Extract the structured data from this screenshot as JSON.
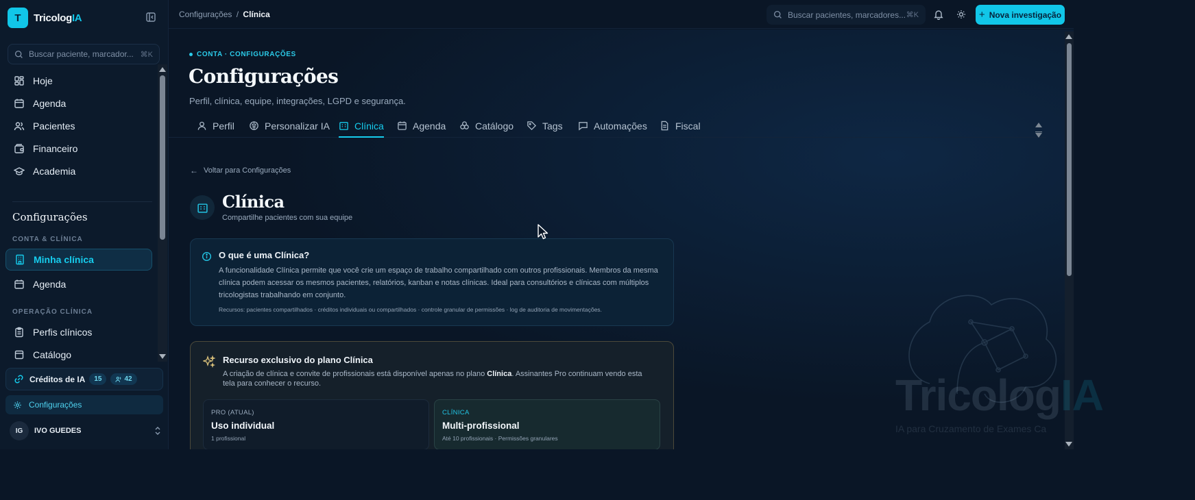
{
  "brand": {
    "logo_letter": "T",
    "name_main": "Tricolog",
    "name_accent": "IA"
  },
  "sidebar": {
    "search_placeholder": "Buscar paciente, marcador...",
    "search_kbd": "⌘K",
    "main_nav": [
      {
        "label": "Hoje",
        "icon": "dashboard-icon"
      },
      {
        "label": "Agenda",
        "icon": "calendar-icon"
      },
      {
        "label": "Pacientes",
        "icon": "users-icon"
      },
      {
        "label": "Financeiro",
        "icon": "wallet-icon"
      },
      {
        "label": "Academia",
        "icon": "graduation-cap-icon"
      }
    ],
    "settings_heading": "Configurações",
    "section_1": "CONTA & CLÍNICA",
    "section_1_items": [
      {
        "label": "Minha clínica",
        "icon": "building-icon",
        "active": true
      },
      {
        "label": "Agenda",
        "icon": "calendar-icon"
      }
    ],
    "section_2": "OPERAÇÃO CLÍNICA",
    "section_2_items": [
      {
        "label": "Perfis clínicos",
        "icon": "clipboard-icon"
      },
      {
        "label": "Catálogo",
        "icon": "catalog-icon"
      }
    ],
    "credits": {
      "label": "Créditos de IA",
      "count_1": "15",
      "count_2": "42"
    },
    "settings_link": "Configurações",
    "user": {
      "initials": "IG",
      "name": "IVO GUEDES"
    }
  },
  "topbar": {
    "breadcrumb_parent": "Configurações",
    "breadcrumb_sep": "/",
    "breadcrumb_current": "Clínica",
    "search_placeholder": "Buscar pacientes, marcadores...",
    "search_kbd": "⌘K",
    "new_button": "Nova investigação"
  },
  "page": {
    "eyebrow": "CONTA · CONFIGURAÇÕES",
    "title": "Configurações",
    "subtitle": "Perfil, clínica, equipe, integrações, LGPD e segurança.",
    "tabs": [
      {
        "label": "Perfil",
        "icon": "user-icon"
      },
      {
        "label": "Personalizar IA",
        "icon": "brain-icon"
      },
      {
        "label": "Clínica",
        "icon": "building-icon",
        "active": true
      },
      {
        "label": "Agenda",
        "icon": "calendar-icon"
      },
      {
        "label": "Catálogo",
        "icon": "catalog-icon"
      },
      {
        "label": "Tags",
        "icon": "tag-icon"
      },
      {
        "label": "Automações",
        "icon": "message-icon"
      },
      {
        "label": "Fiscal",
        "icon": "file-icon"
      }
    ],
    "back_link": "Voltar para Configurações",
    "section_title": "Clínica",
    "section_subtitle": "Compartilhe pacientes com sua equipe"
  },
  "info_card": {
    "title": "O que é uma Clínica?",
    "text": "A funcionalidade Clínica permite que você crie um espaço de trabalho compartilhado com outros profissionais. Membros da mesma clínica podem acessar os mesmos pacientes, relatórios, kanban e notas clínicas. Ideal para consultórios e clínicas com múltiplos tricologistas trabalhando em conjunto.",
    "resources": "Recursos: pacientes compartilhados · créditos individuais ou compartilhados · controle granular de permissões · log de auditoria de movimentações."
  },
  "exclusive_card": {
    "title": "Recurso exclusivo do plano Clínica",
    "text_before": "A criação de clínica e convite de profissionais está disponível apenas no plano ",
    "text_bold": "Clínica",
    "text_after": ". Assinantes Pro continuam vendo esta tela para conhecer o recurso.",
    "plans": [
      {
        "tag": "PRO (ATUAL)",
        "name": "Uso individual",
        "desc": "1 profissional"
      },
      {
        "tag": "CLÍNICA",
        "name": "Multi-profissional",
        "desc": "Até 10 profissionais · Permissões granulares"
      }
    ]
  },
  "watermark": {
    "name_main": "Tricolog",
    "name_accent": "IA",
    "tagline": "IA para Cruzamento de Exames Ca"
  },
  "colors": {
    "accent": "#11c6e8",
    "background": "#0a1626",
    "sidebar": "#0c1a2b",
    "warning_border": "#4c4a3a"
  }
}
